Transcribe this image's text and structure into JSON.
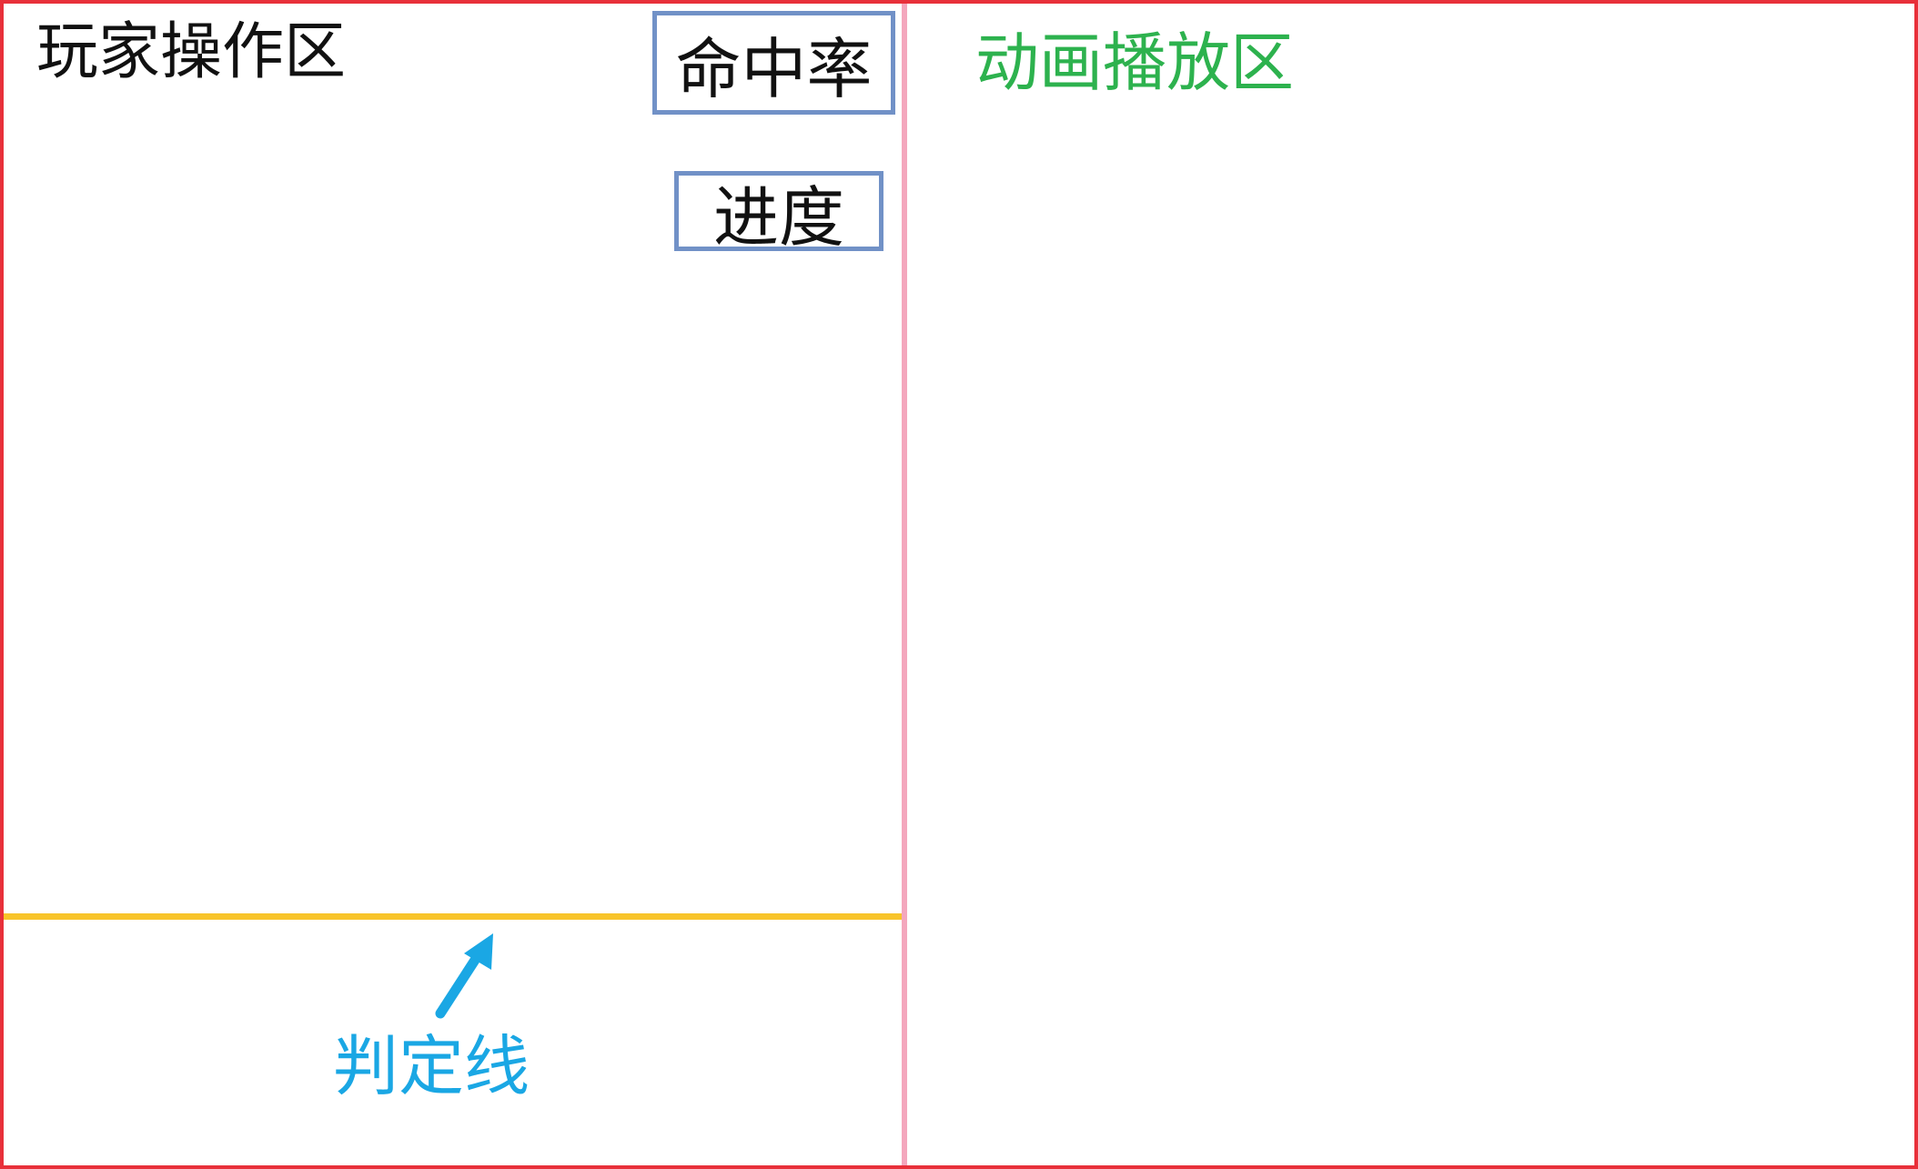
{
  "player_area": {
    "title": "玩家操作区",
    "hit_rate_label": "命中率",
    "progress_label": "进度",
    "judge_line_label": "判定线"
  },
  "animation_area": {
    "title": "动画播放区"
  },
  "colors": {
    "frame": "#e8303a",
    "divider": "#f4a7bd",
    "judge_line": "#f8c42a",
    "box_border": "#7191c7",
    "animation_title": "#2db24e",
    "judge_annotation": "#1aa7e4"
  },
  "icons": {
    "judge_pointer": "arrow-up-right-icon"
  }
}
